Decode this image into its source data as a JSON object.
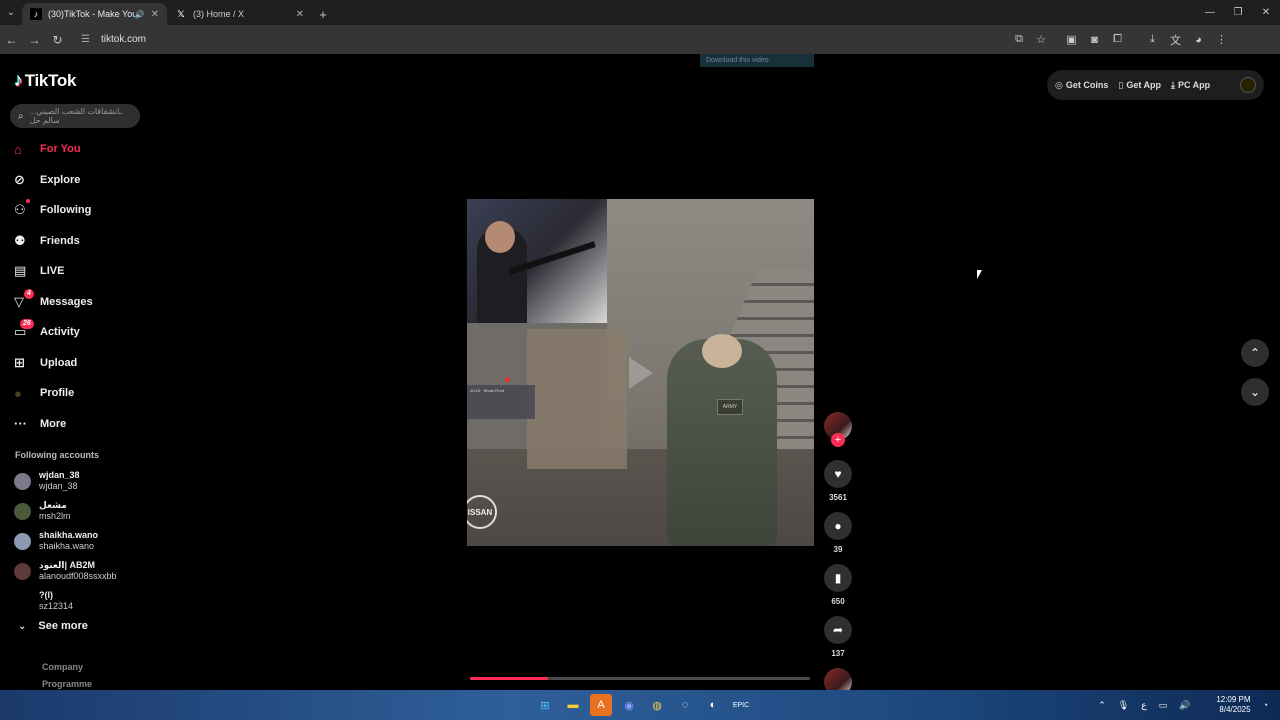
{
  "browser": {
    "tabs": [
      {
        "title": "(30)TikTok - Make Your Day",
        "favicon": "tiktok-icon",
        "active": true
      },
      {
        "title": "(3) Home / X",
        "favicon": "x-icon",
        "active": false
      }
    ],
    "url": "tiktok.com"
  },
  "sidebar": {
    "logo": "TikTok",
    "search_placeholder": "...ـانشقاقات الشعب الصيني سالم حل",
    "nav": [
      {
        "label": "For You",
        "icon": "home-icon",
        "active": true
      },
      {
        "label": "Explore",
        "icon": "compass-icon"
      },
      {
        "label": "Following",
        "icon": "following-icon"
      },
      {
        "label": "Friends",
        "icon": "friends-icon"
      },
      {
        "label": "LIVE",
        "icon": "live-icon"
      },
      {
        "label": "Messages",
        "icon": "messages-icon",
        "badge": "4"
      },
      {
        "label": "Activity",
        "icon": "activity-icon",
        "badge": "26"
      },
      {
        "label": "Upload",
        "icon": "upload-icon"
      },
      {
        "label": "Profile",
        "icon": "profile-icon"
      },
      {
        "label": "More",
        "icon": "more-icon"
      }
    ],
    "following_title": "Following accounts",
    "accounts": [
      {
        "name": "wjdan_38",
        "handle": "wjdan_38",
        "color": "#7a7a8a"
      },
      {
        "name": "مشعل",
        "handle": "msh2lm",
        "color": "#4a5a3a"
      },
      {
        "name": "shaikha.wano",
        "handle": "shaikha.wano",
        "color": "#8a9ab0"
      },
      {
        "name": "العنود| AB2M",
        "handle": "alanoudf008ssxxbb",
        "color": "#5a3a3a"
      },
      {
        "name": "?(l)",
        "handle": "sz12314",
        "color": "#000000"
      }
    ],
    "see_more": "See more",
    "footer": [
      "Company",
      "Programme"
    ]
  },
  "top_right": {
    "get_coins": "Get Coins",
    "get_app": "Get App",
    "pc_app": "PC App"
  },
  "download_banner": "Download this video",
  "video": {
    "overlay_card_title": "10:15 · Shots Fired",
    "soldier_patch": "ARMY",
    "sponsor_logo": "ISSAN",
    "progress": 0.23
  },
  "actions": {
    "likes": "3561",
    "comments": "39",
    "saves": "650",
    "shares": "137"
  },
  "taskbar": {
    "time": "12:09 PM",
    "date": "8/4/2025",
    "lang": "ع"
  },
  "colors": {
    "accent": "#fe2c55",
    "background": "#000000"
  }
}
